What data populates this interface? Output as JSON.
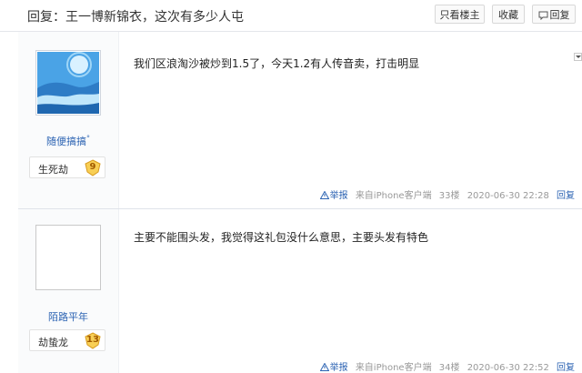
{
  "header": {
    "title": "回复：王一博新锦衣，这次有多少人屯",
    "buttons": {
      "only_louzhu": "只看楼主",
      "collect": "收藏",
      "reply": "回复"
    }
  },
  "posts": [
    {
      "username": "随便搞搞",
      "title_badge": "生死劫",
      "level": "9",
      "content": "我们区浪淘沙被炒到1.5了，今天1.2有人传音卖，打击明显",
      "report": "举报",
      "source": "来自iPhone客户端",
      "floor": "33楼",
      "time": "2020-06-30 22:28",
      "reply": "回复"
    },
    {
      "username": "陌路平年",
      "title_badge": "劫蛰龙",
      "level": "13",
      "content": "主要不能围头发，我觉得这礼包没什么意思，主要头发有特色",
      "report": "举报",
      "source": "来自iPhone客户端",
      "floor": "34楼",
      "time": "2020-06-30 22:52",
      "reply": "回复"
    }
  ],
  "icons": {
    "reply": "speech-bubble-icon",
    "report": "warning-triangle-icon",
    "level": "shield-icon",
    "options": "chevron-down-icon"
  },
  "colors": {
    "link": "#2d64b3",
    "level_badge": "#f5c04a"
  }
}
